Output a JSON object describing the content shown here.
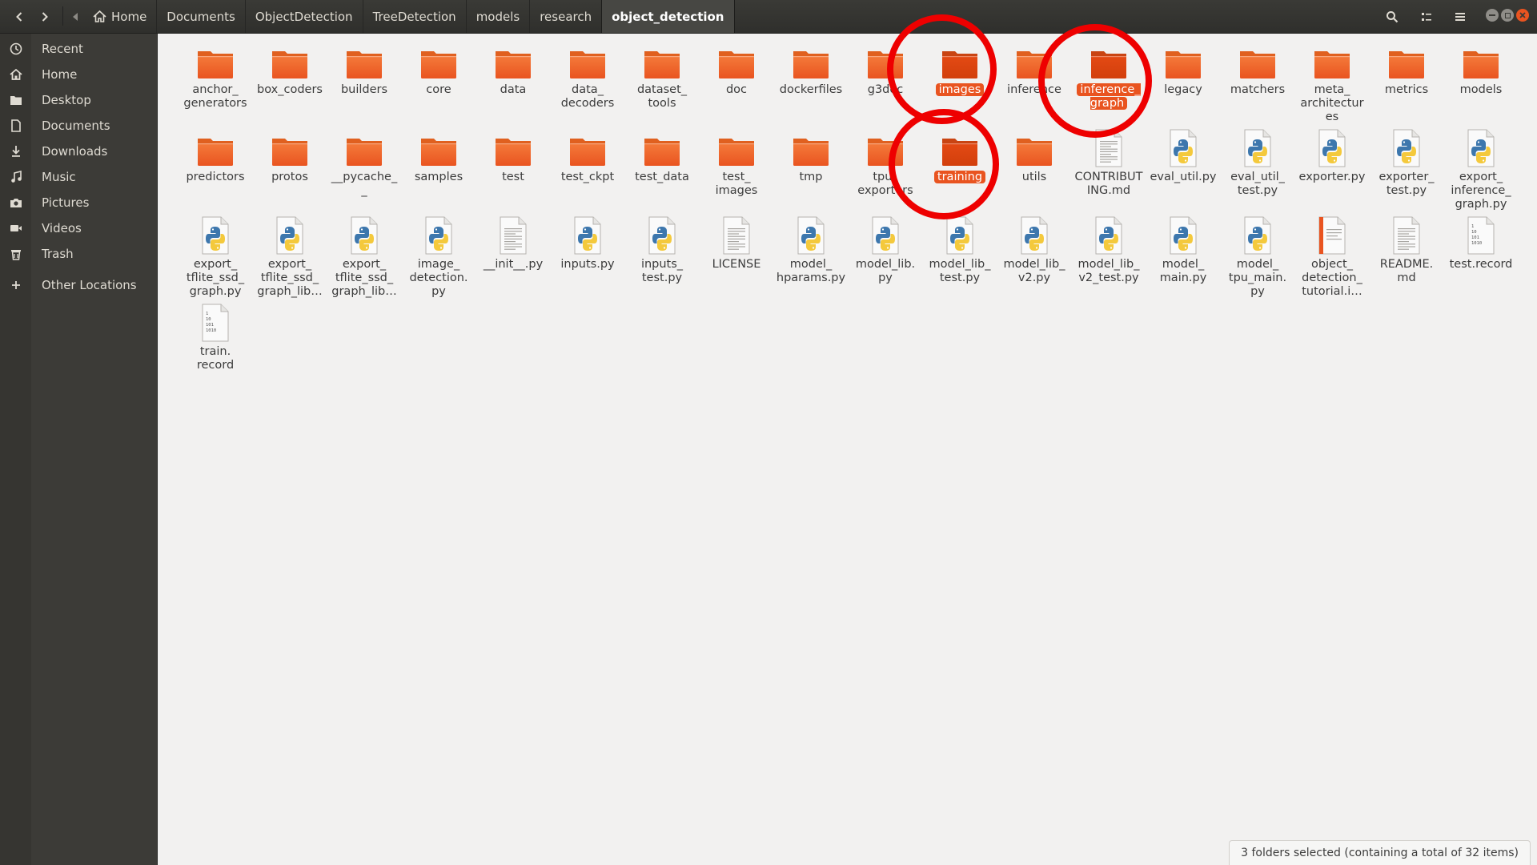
{
  "header": {
    "breadcrumbs": [
      "Home",
      "Documents",
      "ObjectDetection",
      "TreeDetection",
      "models",
      "research",
      "object_detection"
    ],
    "active_crumb": "object_detection"
  },
  "sidebar": {
    "items": [
      {
        "label": "Recent",
        "icon": "clock-icon"
      },
      {
        "label": "Home",
        "icon": "home-icon"
      },
      {
        "label": "Desktop",
        "icon": "desktop-icon"
      },
      {
        "label": "Documents",
        "icon": "document-icon"
      },
      {
        "label": "Downloads",
        "icon": "download-icon"
      },
      {
        "label": "Music",
        "icon": "music-icon"
      },
      {
        "label": "Pictures",
        "icon": "camera-icon"
      },
      {
        "label": "Videos",
        "icon": "video-icon"
      },
      {
        "label": "Trash",
        "icon": "trash-icon"
      }
    ],
    "other_locations": "Other Locations"
  },
  "files": [
    {
      "name": "anchor_\ngenerators",
      "type": "folder"
    },
    {
      "name": "box_coders",
      "type": "folder"
    },
    {
      "name": "builders",
      "type": "folder"
    },
    {
      "name": "core",
      "type": "folder"
    },
    {
      "name": "data",
      "type": "folder"
    },
    {
      "name": "data_\ndecoders",
      "type": "folder"
    },
    {
      "name": "dataset_\ntools",
      "type": "folder"
    },
    {
      "name": "doc",
      "type": "folder"
    },
    {
      "name": "dockerfiles",
      "type": "folder"
    },
    {
      "name": "g3doc",
      "type": "folder"
    },
    {
      "name": "images",
      "type": "folder",
      "selected": true
    },
    {
      "name": "inference",
      "type": "folder"
    },
    {
      "name": "inference_\ngraph",
      "type": "folder",
      "selected": true
    },
    {
      "name": "legacy",
      "type": "folder"
    },
    {
      "name": "matchers",
      "type": "folder"
    },
    {
      "name": "meta_\narchitectur\nes",
      "type": "folder"
    },
    {
      "name": "metrics",
      "type": "folder"
    },
    {
      "name": "models",
      "type": "folder"
    },
    {
      "name": "predictors",
      "type": "folder"
    },
    {
      "name": "protos",
      "type": "folder"
    },
    {
      "name": "__pycache_\n_",
      "type": "folder"
    },
    {
      "name": "samples",
      "type": "folder"
    },
    {
      "name": "test",
      "type": "folder"
    },
    {
      "name": "test_ckpt",
      "type": "folder"
    },
    {
      "name": "test_data",
      "type": "folder"
    },
    {
      "name": "test_\nimages",
      "type": "folder"
    },
    {
      "name": "tmp",
      "type": "folder"
    },
    {
      "name": "tpu_\nexporters",
      "type": "folder"
    },
    {
      "name": "training",
      "type": "folder",
      "selected": true
    },
    {
      "name": "utils",
      "type": "folder"
    },
    {
      "name": "CONTRIBUT\nING.md",
      "type": "text"
    },
    {
      "name": "eval_util.py",
      "type": "python"
    },
    {
      "name": "eval_util_\ntest.py",
      "type": "python"
    },
    {
      "name": "exporter.py",
      "type": "python"
    },
    {
      "name": "exporter_\ntest.py",
      "type": "python"
    },
    {
      "name": "export_\ninference_\ngraph.py",
      "type": "python"
    },
    {
      "name": "export_\ntflite_ssd_\ngraph.py",
      "type": "python"
    },
    {
      "name": "export_\ntflite_ssd_\ngraph_lib…",
      "type": "python"
    },
    {
      "name": "export_\ntflite_ssd_\ngraph_lib…",
      "type": "python"
    },
    {
      "name": "image_\ndetection.\npy",
      "type": "python"
    },
    {
      "name": "__init__.py",
      "type": "text"
    },
    {
      "name": "inputs.py",
      "type": "python"
    },
    {
      "name": "inputs_\ntest.py",
      "type": "python"
    },
    {
      "name": "LICENSE",
      "type": "text"
    },
    {
      "name": "model_\nhparams.py",
      "type": "python"
    },
    {
      "name": "model_lib.\npy",
      "type": "python"
    },
    {
      "name": "model_lib_\ntest.py",
      "type": "python"
    },
    {
      "name": "model_lib_\nv2.py",
      "type": "python"
    },
    {
      "name": "model_lib_\nv2_test.py",
      "type": "python"
    },
    {
      "name": "model_\nmain.py",
      "type": "python"
    },
    {
      "name": "model_\ntpu_main.\npy",
      "type": "python"
    },
    {
      "name": "object_\ndetection_\ntutorial.i…",
      "type": "notebook"
    },
    {
      "name": "README.\nmd",
      "type": "text"
    },
    {
      "name": "test.record",
      "type": "binary"
    },
    {
      "name": "train.\nrecord",
      "type": "binary"
    }
  ],
  "status": "3 folders selected  (containing a total of 32 items)",
  "colors": {
    "accent": "#e95420",
    "folder": "#e95420",
    "annotation": "#ee0000"
  }
}
